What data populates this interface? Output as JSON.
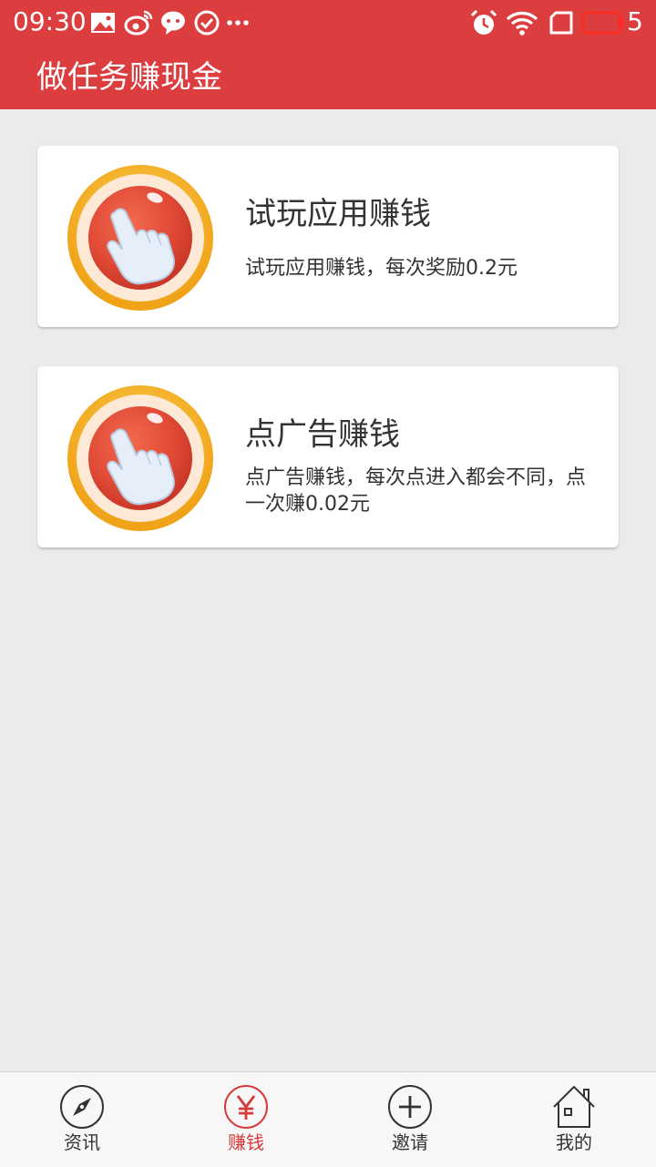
{
  "status_bar": {
    "time": "09:30",
    "battery_level": "5",
    "icons": [
      "image-icon",
      "weibo-icon",
      "chat-bubble-icon",
      "check-circle-icon",
      "more-dots-icon",
      "alarm-icon",
      "wifi-icon",
      "sim-card-icon",
      "battery-icon"
    ]
  },
  "header": {
    "title": "做任务赚现金"
  },
  "tasks": [
    {
      "title": "试玩应用赚钱",
      "description": "试玩应用赚钱，每次奖励0.2元",
      "icon": "pointing-hand-icon"
    },
    {
      "title": "点广告赚钱",
      "description": "点广告赚钱，每次点进入都会不同，点一次赚0.02元",
      "icon": "pointing-hand-icon"
    }
  ],
  "bottom_nav": {
    "items": [
      {
        "label": "资讯",
        "icon": "compass-icon"
      },
      {
        "label": "赚钱",
        "icon": "yen-icon",
        "active": true
      },
      {
        "label": "邀请",
        "icon": "plus-circle-icon"
      },
      {
        "label": "我的",
        "icon": "home-icon"
      }
    ]
  },
  "colors": {
    "primary_red": "#dc3d3f",
    "active_tab": "#d43c3c",
    "background": "#ebebeb",
    "card_background": "#ffffff",
    "icon_ring": "#f2ad1f"
  }
}
